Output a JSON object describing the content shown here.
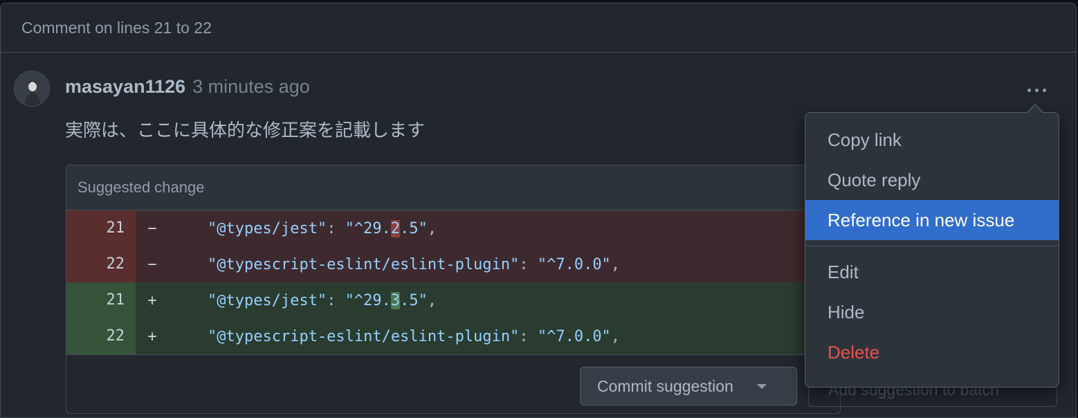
{
  "header": {
    "title": "Comment on lines 21 to 22"
  },
  "comment": {
    "author": "masayan1126",
    "time": "3 minutes ago",
    "body": "実際は、ここに具体的な修正案を記載します"
  },
  "suggestion": {
    "title": "Suggested change",
    "rows": [
      {
        "type": "del",
        "line": "21",
        "sign": "−",
        "key": "\"@types/jest\"",
        "sep": ": ",
        "pre": "\"^29.",
        "hl": "2",
        "post": ".5\"",
        "tail": ","
      },
      {
        "type": "del",
        "line": "22",
        "sign": "−",
        "key": "\"@typescript-eslint/eslint-plugin\"",
        "sep": ": ",
        "pre": "\"^7.0.0\"",
        "hl": "",
        "post": "",
        "tail": ","
      },
      {
        "type": "add",
        "line": "21",
        "sign": "+",
        "key": "\"@types/jest\"",
        "sep": ": ",
        "pre": "\"^29.",
        "hl": "3",
        "post": ".5\"",
        "tail": ","
      },
      {
        "type": "add",
        "line": "22",
        "sign": "+",
        "key": "\"@typescript-eslint/eslint-plugin\"",
        "sep": ": ",
        "pre": "\"^7.0.0\"",
        "hl": "",
        "post": "",
        "tail": ","
      }
    ],
    "commit_label": "Commit suggestion",
    "batch_label": "Add suggestion to batch"
  },
  "menu": {
    "items": [
      {
        "label": "Copy link"
      },
      {
        "label": "Quote reply"
      },
      {
        "label": "Reference in new issue"
      },
      {
        "label": "Edit"
      },
      {
        "label": "Hide"
      },
      {
        "label": "Delete"
      }
    ]
  },
  "colors": {
    "background": "#22272e",
    "menu_active": "#316dca",
    "danger": "#e5534b",
    "diff_del": "#3e2a2e",
    "diff_add": "#2a3c30"
  }
}
